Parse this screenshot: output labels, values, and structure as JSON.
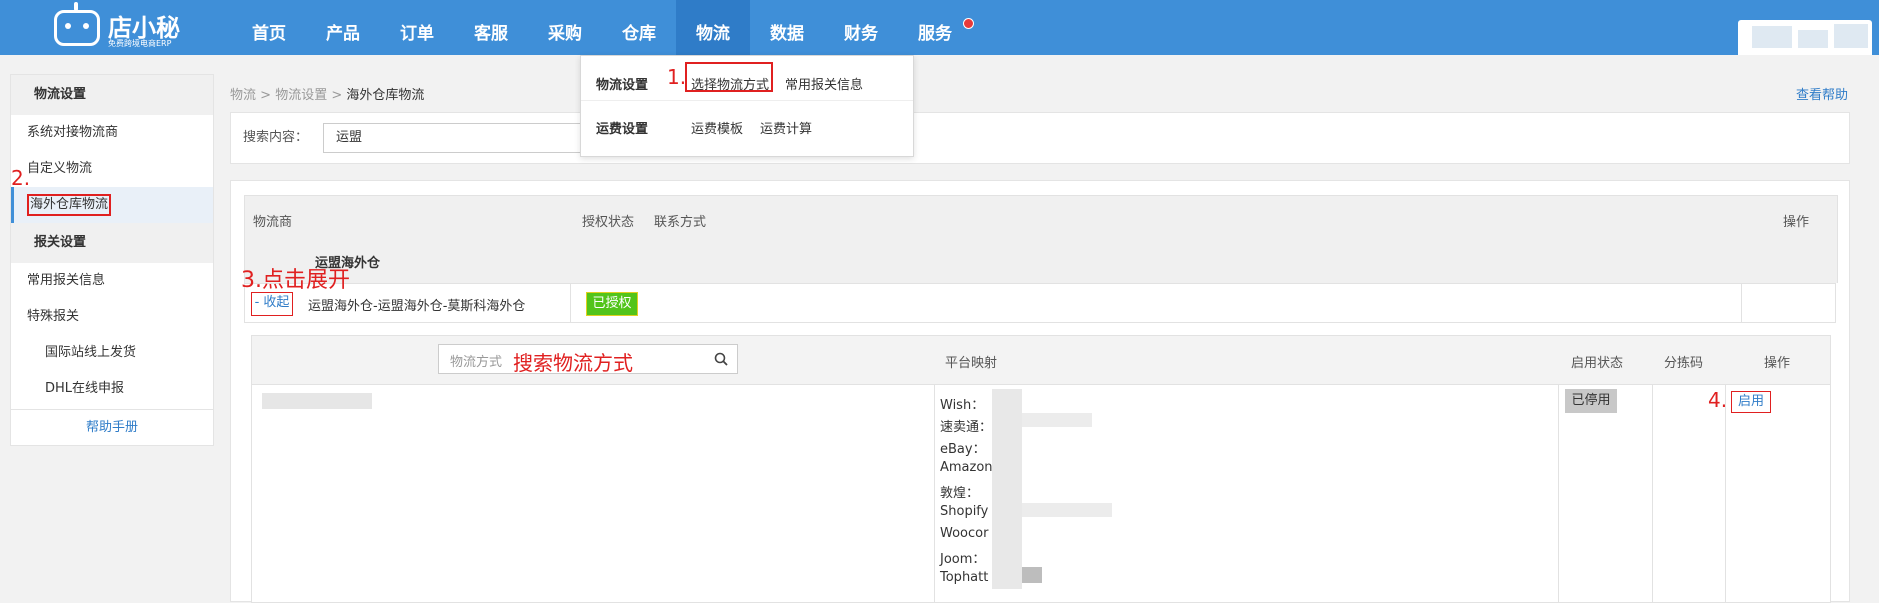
{
  "app": {
    "name": "店小秘",
    "slogan": "免费跨境电商ERP"
  },
  "nav": {
    "items": [
      "首页",
      "产品",
      "订单",
      "客服",
      "采购",
      "仓库",
      "物流",
      "数据",
      "财务",
      "服务"
    ],
    "active": "物流"
  },
  "dropdown": {
    "row1_head": "物流设置",
    "row1_links": [
      "选择物流方式",
      "常用报关信息"
    ],
    "row2_head": "运费设置",
    "row2_links": [
      "运费模板",
      "运费计算"
    ]
  },
  "sidebar": {
    "group1": "物流设置",
    "items1": [
      "系统对接物流商",
      "自定义物流",
      "海外仓库物流"
    ],
    "group2": "报关设置",
    "items2": [
      "常用报关信息",
      "特殊报关"
    ],
    "sub_items": [
      "国际站线上发货",
      "DHL在线申报"
    ],
    "help": "帮助手册"
  },
  "breadcrumb": {
    "parts": [
      "物流",
      "物流设置"
    ],
    "current": "海外仓库物流",
    "sep": ">"
  },
  "help_link": "查看帮助",
  "search": {
    "label": "搜索内容：",
    "value": "运盟"
  },
  "table": {
    "headers": [
      "物流商",
      "授权状态",
      "联系方式",
      "操作"
    ],
    "group_name": "运盟海外仓",
    "collapse_label": "- 收起",
    "provider_name": "运盟海外仓-运盟海外仓-莫斯科海外仓",
    "auth_status": "已授权"
  },
  "inner": {
    "search_placeholder": "物流方式",
    "headers": [
      "平台映射",
      "启用状态",
      "分拣码",
      "操作"
    ],
    "platforms": [
      "Wish：",
      "速卖通：",
      "eBay：",
      "Amazon",
      "敦煌：",
      "Shopify",
      "Woocor",
      "Joom：",
      "Tophatt"
    ],
    "status": "已停用",
    "enable_label": "启用"
  },
  "annotations": {
    "a1": "1.",
    "a2": "2.",
    "a3": "3.点击展开",
    "a4": "4.",
    "search_hint": "搜索物流方式",
    "color": "#e02020"
  },
  "colors": {
    "brand": "#3f8fd8",
    "auth_green": "#52c41a",
    "link": "#2f7cc8"
  }
}
